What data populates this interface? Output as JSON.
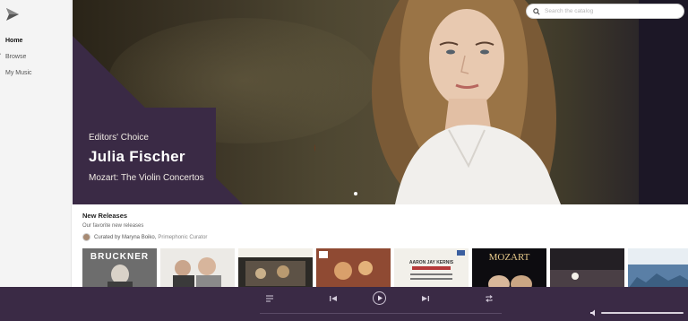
{
  "sidebar": {
    "items": [
      {
        "label": "Home",
        "active": true
      },
      {
        "label": "Browse",
        "active": false
      },
      {
        "label": "My Music",
        "active": false
      }
    ]
  },
  "search": {
    "placeholder": "Search the catalog"
  },
  "hero": {
    "kicker": "Editors' Choice",
    "title": "Julia Fischer",
    "subtitle": "Mozart: The Violin Concertos"
  },
  "new_releases": {
    "title": "New Releases",
    "subtitle": "Our favorite new releases",
    "curated_by": "Curated by Maryna Boiko,",
    "curator_role": "Primephonic Curator"
  },
  "albums": [
    {
      "text": "BRUCKNER"
    },
    {
      "text": ""
    },
    {
      "text": ""
    },
    {
      "text": ""
    },
    {
      "text": "AARON JAY KERNIS"
    },
    {
      "text": "MOZART"
    },
    {
      "text": ""
    },
    {
      "text": ""
    }
  ],
  "colors": {
    "brand_purple": "#3a2a45",
    "sidebar_bg": "#f4f4f4"
  },
  "icons": {
    "logo": "play-triangle-logo",
    "search": "search-icon",
    "queue": "queue-icon",
    "previous": "previous-icon",
    "play": "play-icon",
    "next": "next-icon",
    "repeat": "repeat-icon",
    "volume": "volume-icon"
  }
}
